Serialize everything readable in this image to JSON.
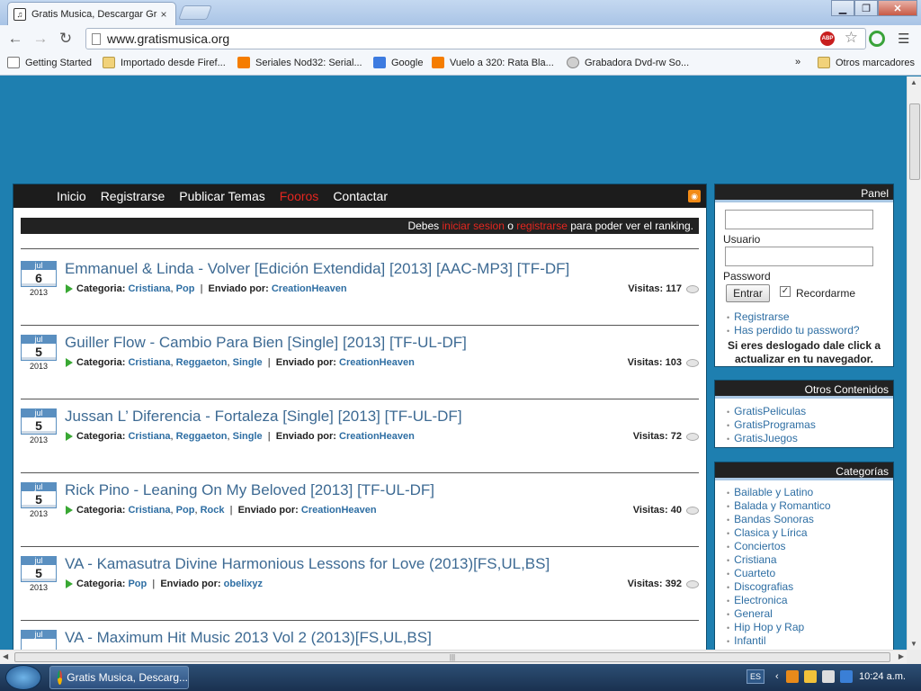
{
  "browser": {
    "tab_title": "Gratis Musica, Descargar Gra",
    "tab_close": "×",
    "url": "www.gratismusica.org",
    "abp_label": "ABP",
    "bookmarks": [
      {
        "label": "Getting Started",
        "icon": "page-icon"
      },
      {
        "label": "Importado desde Firef...",
        "icon": "folder-icon"
      },
      {
        "label": "Seriales Nod32: Serial...",
        "icon": "blogger-icon"
      },
      {
        "label": "Google",
        "icon": "google-icon"
      },
      {
        "label": "Vuelo a 320: Rata Bla...",
        "icon": "blogger-icon"
      },
      {
        "label": "Grabadora Dvd-rw So...",
        "icon": "disc-icon"
      }
    ],
    "bookmarks_overflow": "»",
    "other_bookmarks": "Otros marcadores"
  },
  "site": {
    "nav": [
      {
        "label": "Inicio",
        "active": false
      },
      {
        "label": "Registrarse",
        "active": false
      },
      {
        "label": "Publicar Temas",
        "active": false
      },
      {
        "label": "Fooros",
        "active": true
      },
      {
        "label": "Contactar",
        "active": false
      }
    ],
    "notice": {
      "pre": "Debes ",
      "login": "iniciar sesion",
      "mid": " o ",
      "register": "registrarse",
      "post": " para poder ver el ranking."
    },
    "posts": [
      {
        "month": "jul",
        "day": "6",
        "year": "2013",
        "title": "Emmanuel & Linda - Volver [Edición Extendida] [2013] [AAC-MP3] [TF-DF]",
        "categories": [
          "Cristiana",
          "Pop"
        ],
        "author": "CreationHeaven",
        "visits": "117"
      },
      {
        "month": "jul",
        "day": "5",
        "year": "2013",
        "title": "Guiller Flow - Cambio Para Bien [Single] [2013] [TF-UL-DF]",
        "categories": [
          "Cristiana",
          "Reggaeton",
          "Single"
        ],
        "author": "CreationHeaven",
        "visits": "103"
      },
      {
        "month": "jul",
        "day": "5",
        "year": "2013",
        "title": "Jussan L’ Diferencia - Fortaleza [Single] [2013] [TF-UL-DF]",
        "categories": [
          "Cristiana",
          "Reggaeton",
          "Single"
        ],
        "author": "CreationHeaven",
        "visits": "72"
      },
      {
        "month": "jul",
        "day": "5",
        "year": "2013",
        "title": "Rick Pino - Leaning On My Beloved [2013] [TF-UL-DF]",
        "categories": [
          "Cristiana",
          "Pop",
          "Rock"
        ],
        "author": "CreationHeaven",
        "visits": "40"
      },
      {
        "month": "jul",
        "day": "5",
        "year": "2013",
        "title": "VA - Kamasutra Divine Harmonious Lessons for Love (2013)[FS,UL,BS]",
        "categories": [
          "Pop"
        ],
        "author": "obelixyz",
        "visits": "392"
      },
      {
        "month": "jul",
        "day": "",
        "year": "",
        "title": "VA - Maximum Hit Music 2013 Vol 2 (2013)[FS,UL,BS]",
        "categories": [],
        "author": "",
        "visits": ""
      }
    ],
    "labels": {
      "category": "Categoria:",
      "sent_by": "Enviado por:",
      "visits": "Visitas:"
    },
    "panel": {
      "title": "Panel",
      "user_label": "Usuario",
      "password_label": "Password",
      "login_button": "Entrar",
      "remember_label": "Recordarme",
      "remember_checked": true,
      "links": [
        "Registrarse",
        "Has perdido tu password?"
      ],
      "note": "Si eres deslogado dale click a actualizar en tu navegador."
    },
    "otros": {
      "title": "Otros Contenidos",
      "links": [
        "GratisPeliculas",
        "GratisProgramas",
        "GratisJuegos"
      ]
    },
    "categorias": {
      "title": "Categorías",
      "links": [
        "Bailable y Latino",
        "Balada y Romantico",
        "Bandas Sonoras",
        "Clasica y Lírica",
        "Conciertos",
        "Cristiana",
        "Cuarteto",
        "Discografias",
        "Electronica",
        "General",
        "Hip Hop y Rap",
        "Infantil"
      ]
    }
  },
  "taskbar": {
    "task_label": "Gratis Musica, Descarg...",
    "lang": "ES",
    "clock": "10:24 a.m."
  },
  "colors": {
    "page_bg": "#1e7fb0",
    "nav_active": "#e5261f",
    "link": "#2e6ea3",
    "title": "#3d6a93"
  }
}
